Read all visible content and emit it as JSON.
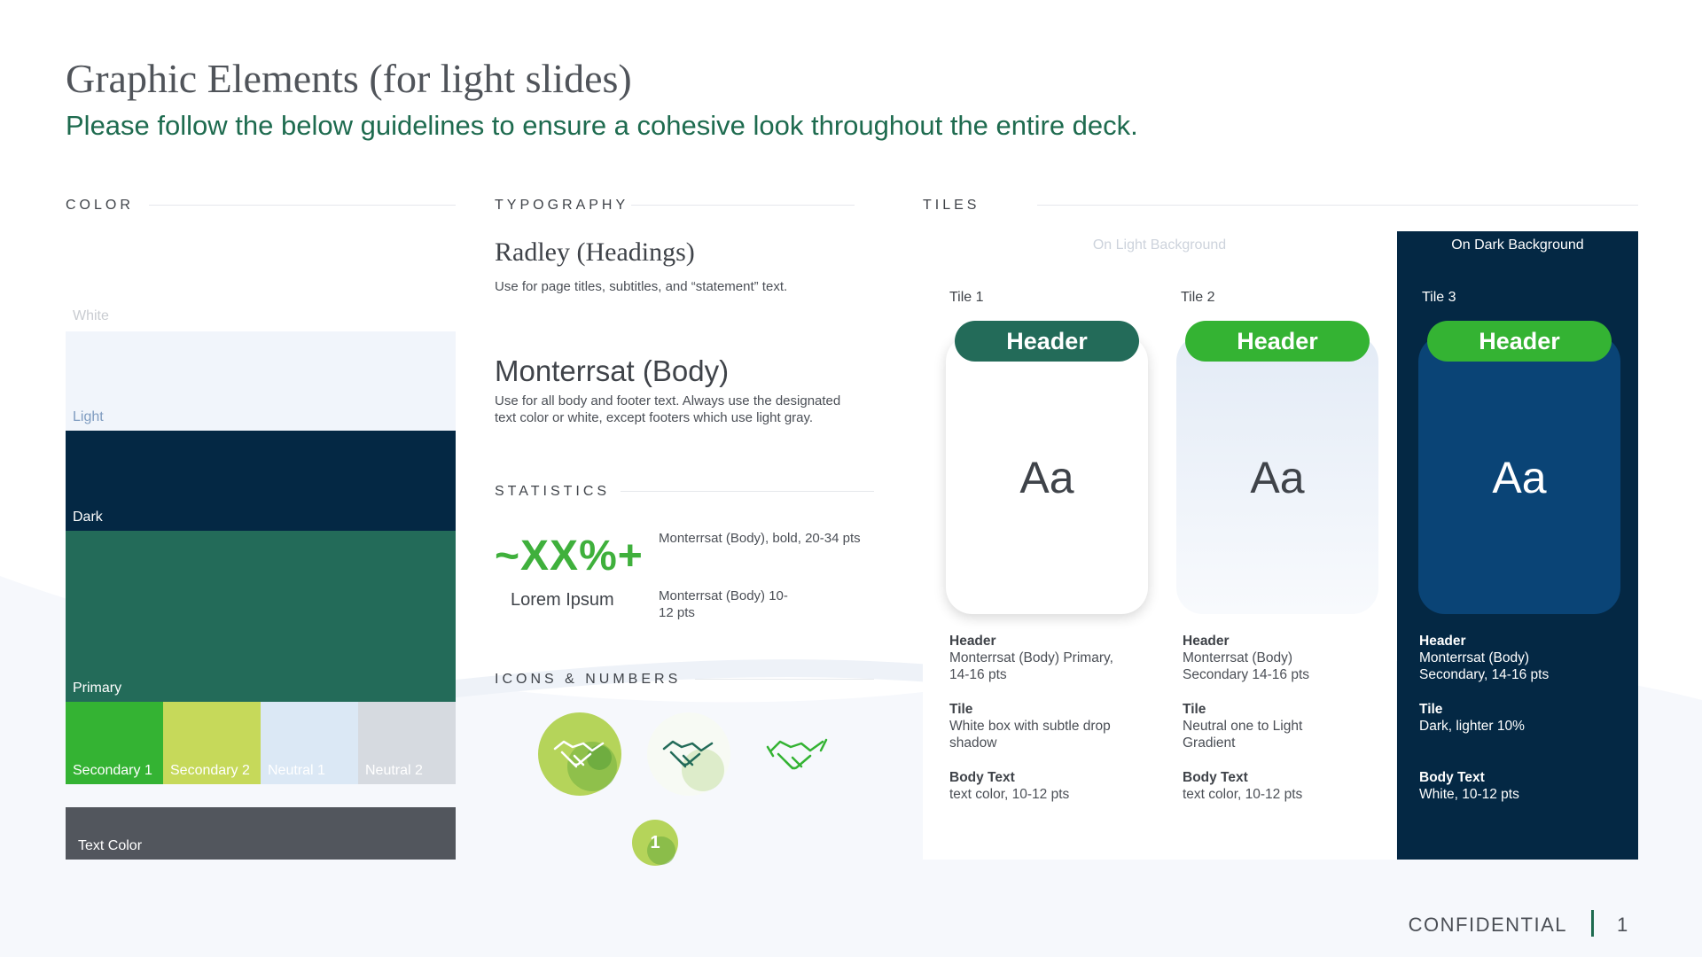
{
  "page": {
    "title": "Graphic Elements (for light slides)",
    "subtitle": "Please follow the below guidelines to ensure a cohesive look throughout the entire deck."
  },
  "color_section": {
    "label": "COLOR",
    "swatches": [
      {
        "label": "White",
        "hex": "#ffffff"
      },
      {
        "label": "Light",
        "hex": "#f1f5fb"
      },
      {
        "label": "Dark",
        "hex": "#042844"
      },
      {
        "label": "Primary",
        "hex": "#236b59"
      },
      {
        "label": "Secondary 1",
        "hex": "#34b333"
      },
      {
        "label": "Secondary 2",
        "hex": "#c6d95a"
      },
      {
        "label": "Neutral 1",
        "hex": "#dbe8f5"
      },
      {
        "label": "Neutral 2",
        "hex": "#d6dae0"
      },
      {
        "label": "Text Color",
        "hex": "#52565d"
      }
    ]
  },
  "typography_section": {
    "label": "TYPOGRAPHY",
    "heading_font": "Radley (Headings)",
    "heading_desc": "Use for page titles, subtitles, and “statement” text.",
    "body_font": "Monterrsat (Body)",
    "body_desc": "Use for all body and footer text. Always use the designated text color or white, except footers which use light gray."
  },
  "statistics_section": {
    "label": "STATISTICS",
    "big_value": "~XX%+",
    "big_desc": "Monterrsat (Body),  bold, 20-34 pts",
    "sub_value": "Lorem Ipsum",
    "sub_desc": "Monterrsat (Body) 10-12 pts"
  },
  "icons_section": {
    "label": "ICONS & NUMBERS",
    "icons": [
      "handshake-icon",
      "handshake-icon",
      "handshake-icon"
    ],
    "number_badge": "1"
  },
  "tiles_section": {
    "label": "TILES",
    "light_heading": "On Light Background",
    "dark_heading": "On Dark Background",
    "tiles": [
      {
        "name": "Tile 1",
        "header": "Header",
        "sample": "Aa",
        "notes": [
          {
            "title": "Header",
            "text": "Monterrsat (Body) Primary, 14-16 pts"
          },
          {
            "title": "Tile",
            "text": "White box with subtle drop shadow"
          },
          {
            "title": "Body Text",
            "text": "text color, 10-12 pts"
          }
        ]
      },
      {
        "name": "Tile 2",
        "header": "Header",
        "sample": "Aa",
        "notes": [
          {
            "title": "Header",
            "text": "Monterrsat (Body) Secondary 14-16 pts"
          },
          {
            "title": "Tile",
            "text": "Neutral one to Light Gradient"
          },
          {
            "title": "Body Text",
            "text": "text color, 10-12 pts"
          }
        ]
      },
      {
        "name": "Tile 3",
        "header": "Header",
        "sample": "Aa",
        "notes": [
          {
            "title": "Header",
            "text": "Monterrsat (Body) Secondary, 14-16 pts"
          },
          {
            "title": "Tile",
            "text": "Dark, lighter 10%"
          },
          {
            "title": "Body Text",
            "text": "White, 10-12 pts"
          }
        ]
      }
    ]
  },
  "footer": {
    "confidential": "CONFIDENTIAL",
    "page_number": "1"
  },
  "colors": {
    "primary": "#236b59",
    "secondary": "#34b333",
    "dark": "#042844",
    "tile_dark": "#0a4476"
  }
}
